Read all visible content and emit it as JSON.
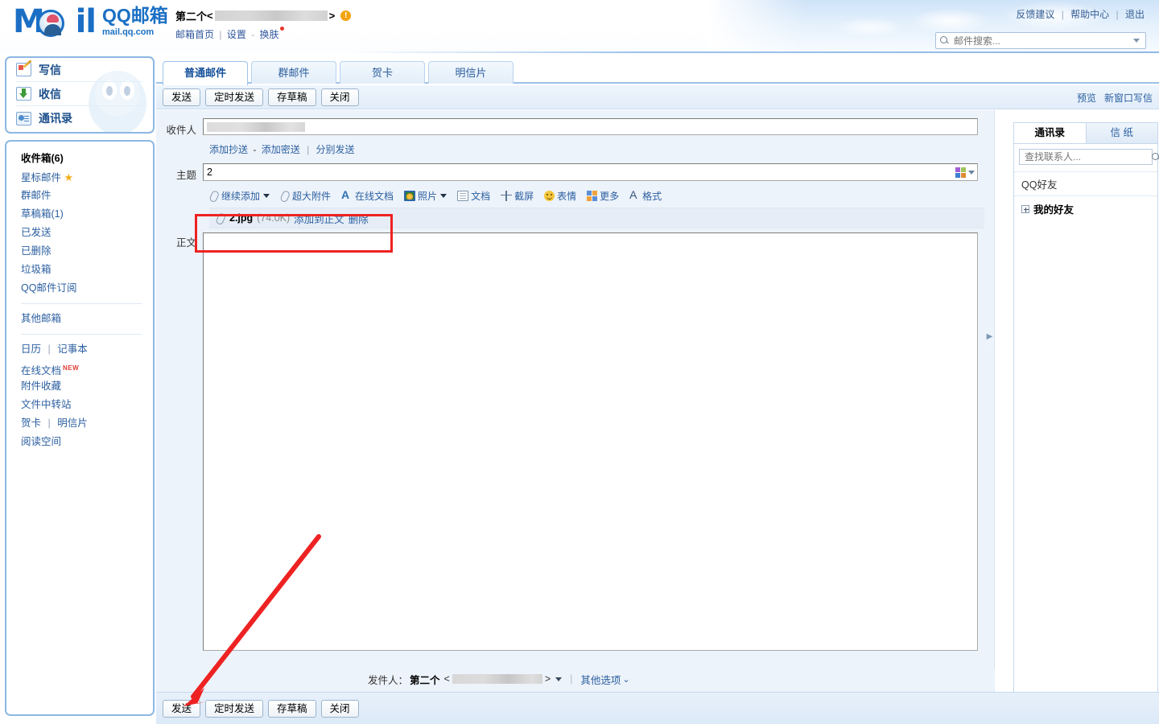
{
  "header": {
    "logo_cn": "QQ邮箱",
    "logo_url": "mail.qq.com",
    "account_name": "第二个",
    "account_lt": "<",
    "account_gt": ">",
    "warn_icon": "warning-icon",
    "links": {
      "home": "邮箱首页",
      "settings": "设置",
      "skin": "换肤"
    },
    "top_links": {
      "feedback": "反馈建议",
      "help": "帮助中心",
      "logout": "退出"
    },
    "search": {
      "placeholder": "邮件搜索...",
      "value": "",
      "icon": "search-icon"
    }
  },
  "sidebar": {
    "main_items": [
      {
        "label": "写信",
        "icon": "write-mail-icon"
      },
      {
        "label": "收信",
        "icon": "receive-mail-icon"
      },
      {
        "label": "通讯录",
        "icon": "address-book-icon"
      }
    ],
    "folders": [
      {
        "label": "收件箱(6)",
        "bold": true
      },
      {
        "label": "星标邮件",
        "star": true
      },
      {
        "label": "群邮件"
      },
      {
        "label": "草稿箱(1)"
      },
      {
        "label": "已发送"
      },
      {
        "label": "已删除"
      },
      {
        "label": "垃圾箱"
      },
      {
        "label": "QQ邮件订阅"
      }
    ],
    "other_mailbox": "其他邮箱",
    "tools": {
      "calendar": "日历",
      "notebook": "记事本",
      "online_doc": "在线文档",
      "online_doc_tag": "NEW",
      "attachment_fav": "附件收藏",
      "file_transfer": "文件中转站",
      "greeting_card": "贺卡",
      "postcard": "明信片",
      "reading_space": "阅读空间"
    }
  },
  "main": {
    "tabs": [
      {
        "label": "普通邮件",
        "active": true
      },
      {
        "label": "群邮件",
        "active": false
      },
      {
        "label": "贺卡",
        "active": false
      },
      {
        "label": "明信片",
        "active": false
      }
    ],
    "toolbar_buttons": [
      "发送",
      "定时发送",
      "存草稿",
      "关闭"
    ],
    "toolbar_right": [
      "预览",
      "新窗口写信"
    ],
    "fields": {
      "to_label": "收件人",
      "to_value": "",
      "cc_add": "添加抄送",
      "bcc_add": "添加密送",
      "send_separately": "分别发送",
      "subject_label": "主题",
      "subject_value": "2",
      "body_label": "正文",
      "body_value": ""
    },
    "attach_tools": [
      {
        "label": "继续添加",
        "icon": "paperclip-icon",
        "caret": true
      },
      {
        "label": "超大附件",
        "icon": "paperclip-icon",
        "caret": false
      },
      {
        "label": "在线文档",
        "icon": "online-doc-icon",
        "caret": false
      },
      {
        "label": "照片",
        "icon": "photo-icon",
        "caret": true
      },
      {
        "label": "文档",
        "icon": "document-icon",
        "caret": false
      },
      {
        "label": "截屏",
        "icon": "screenshot-icon",
        "caret": false
      },
      {
        "label": "表情",
        "icon": "emoji-icon",
        "caret": false
      },
      {
        "label": "更多",
        "icon": "more-grid-icon",
        "caret": false
      },
      {
        "label": "格式",
        "icon": "format-text-icon",
        "caret": false
      }
    ],
    "attachment": {
      "icon": "paperclip-icon",
      "name": "2.jpg",
      "size": "(74.0K)",
      "insert_to_body": "添加到正文",
      "delete": "删除"
    },
    "sender": {
      "label": "发件人：",
      "name": "第二个",
      "lt": "<",
      "gt": ">",
      "divider": "|",
      "other_options": "其他选项"
    },
    "bottom_buttons": [
      "发送",
      "定时发送",
      "存草稿",
      "关闭"
    ]
  },
  "right_panel": {
    "tabs": [
      {
        "label": "通讯录",
        "active": true
      },
      {
        "label": "信 纸",
        "active": false
      }
    ],
    "search_placeholder": "查找联系人...",
    "search_value": "",
    "search_icon": "search-icon",
    "group_header": "QQ好友",
    "group_item": "我的好友",
    "expand_icon": "expand-plus-icon"
  },
  "annotations": {
    "highlight_box": "attachment-highlight",
    "arrow": "send-button-arrow"
  },
  "colors": {
    "brand_blue": "#1a6fc4",
    "link_blue": "#2b5fa0",
    "annotation_red": "#ee2222",
    "panel_bg": "#edf3fa",
    "border_blue": "#8cb8e4"
  }
}
